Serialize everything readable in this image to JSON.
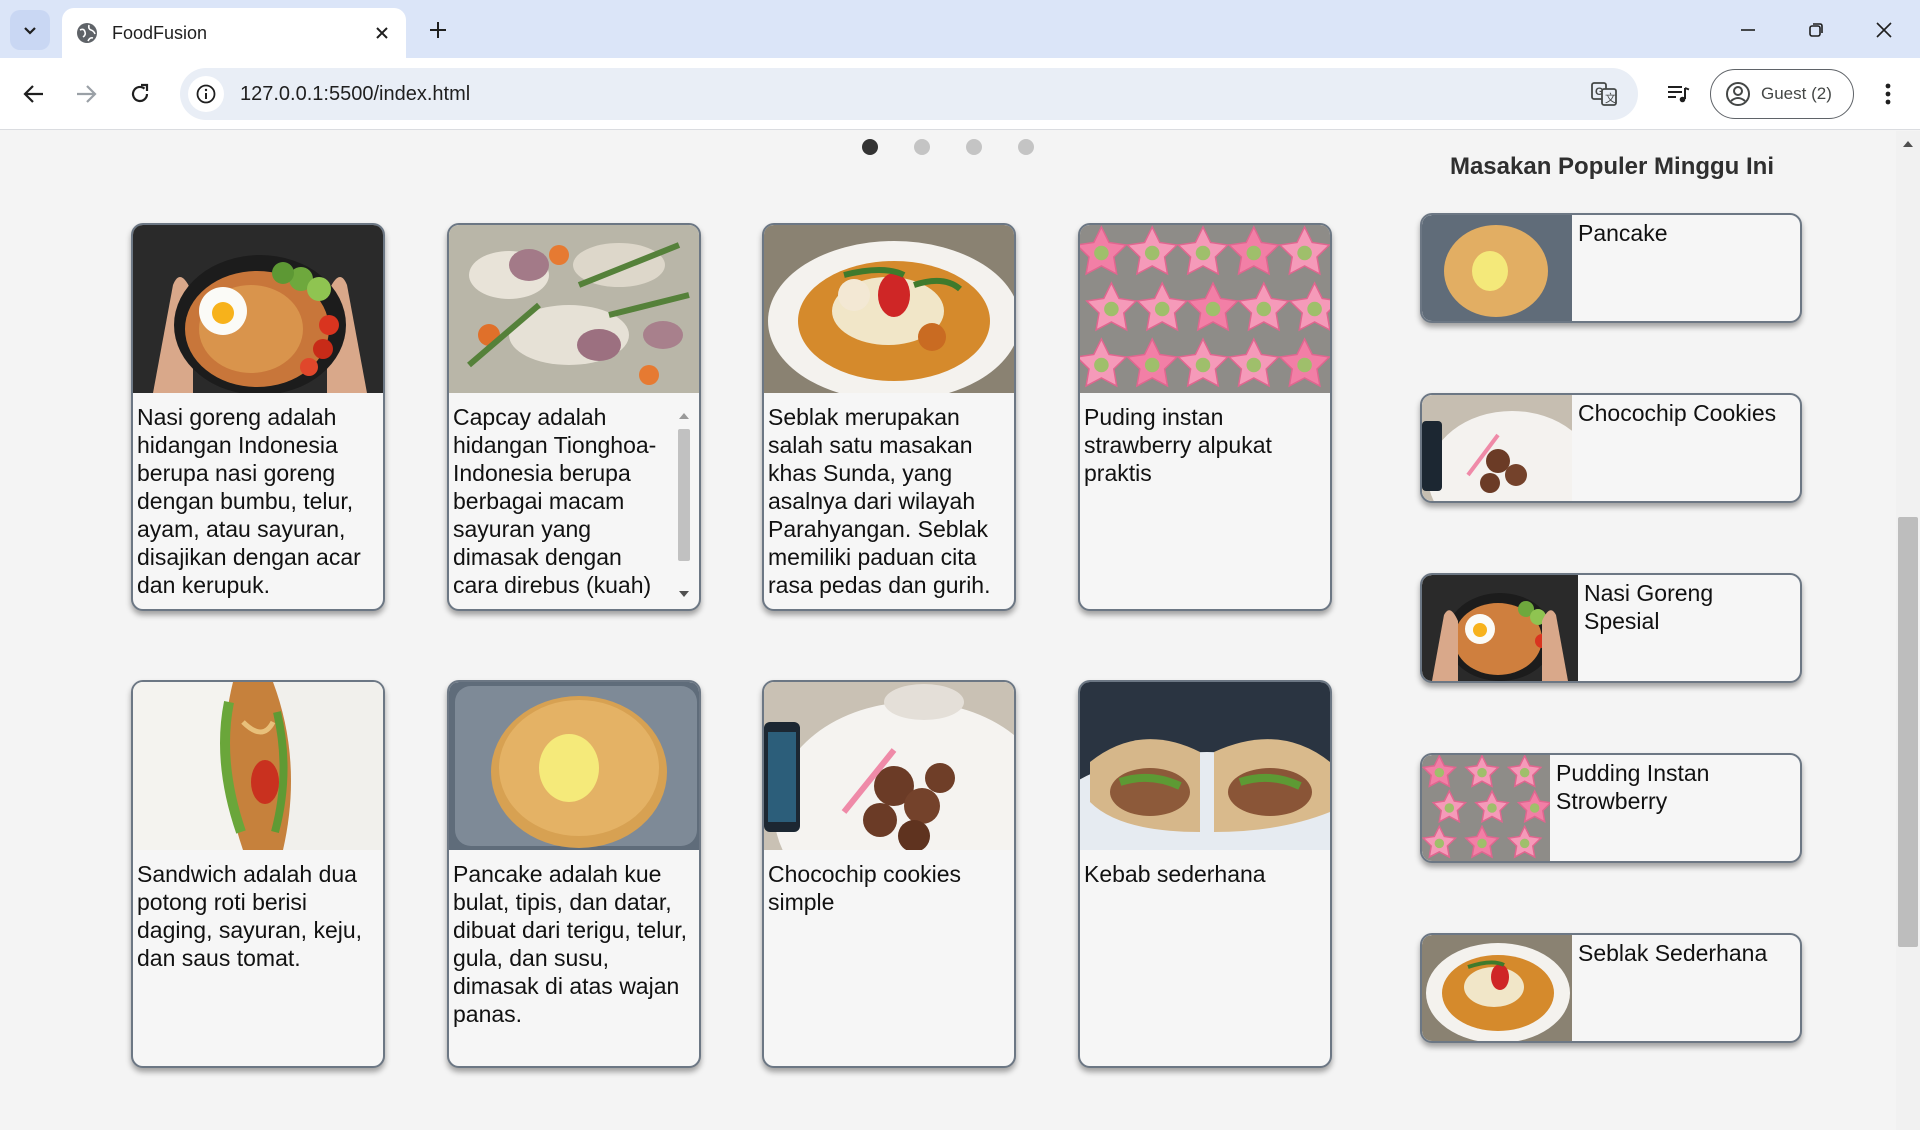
{
  "browser": {
    "tab_title": "FoodFusion",
    "url": "127.0.0.1:5500/index.html",
    "profile_label": "Guest (2)",
    "icons": [
      "chevron-down-icon",
      "globe-icon",
      "close-icon",
      "plus-icon",
      "minimize-icon",
      "restore-icon",
      "window-close-icon",
      "back-icon",
      "forward-icon",
      "reload-icon",
      "info-icon",
      "translate-icon",
      "media-icon",
      "account-icon",
      "more-vert-icon"
    ]
  },
  "carousel": {
    "dot_count": 4,
    "active_index": 0
  },
  "menu_cards": [
    {
      "dish": "nasi-goreng",
      "description": "Nasi goreng adalah hidangan Indonesia berupa nasi goreng dengan bumbu, telur, ayam, atau sayuran, disajikan dengan acar dan kerupuk."
    },
    {
      "dish": "capcay",
      "description": "Capcay adalah hidangan Tionghoa-Indonesia berupa berbagai macam sayuran yang dimasak dengan cara direbus (kuah)"
    },
    {
      "dish": "seblak",
      "description": "Seblak merupakan salah satu masakan khas Sunda, yang asalnya dari wilayah Parahyangan. Seblak memiliki paduan cita rasa pedas dan gurih."
    },
    {
      "dish": "puding",
      "description": "Puding instan strawberry alpukat praktis"
    },
    {
      "dish": "sandwich",
      "description": "Sandwich adalah dua potong roti berisi daging, sayuran, keju, dan saus tomat."
    },
    {
      "dish": "pancake",
      "description": "Pancake adalah kue bulat, tipis, dan datar, dibuat dari terigu, telur, gula, dan susu, dimasak di atas wajan panas."
    },
    {
      "dish": "chocochip",
      "description": "Chocochip cookies simple"
    },
    {
      "dish": "kebab",
      "description": "Kebab sederhana"
    }
  ],
  "popular": {
    "title": "Masakan Populer Minggu Ini",
    "items": [
      {
        "dish": "pancake",
        "name": "Pancake"
      },
      {
        "dish": "chocochip",
        "name": "Chocochip Cookies"
      },
      {
        "dish": "nasi-goreng",
        "name": "Nasi Goreng Spesial"
      },
      {
        "dish": "puding",
        "name": "Pudding Instan Strowberry"
      },
      {
        "dish": "seblak",
        "name": "Seblak Sederhana"
      }
    ]
  },
  "colors": {
    "tabstrip": "#dbe5f8",
    "omnibox": "#e9eef6",
    "page_background": "#f4f4f4",
    "card_border": "#6c7784"
  }
}
